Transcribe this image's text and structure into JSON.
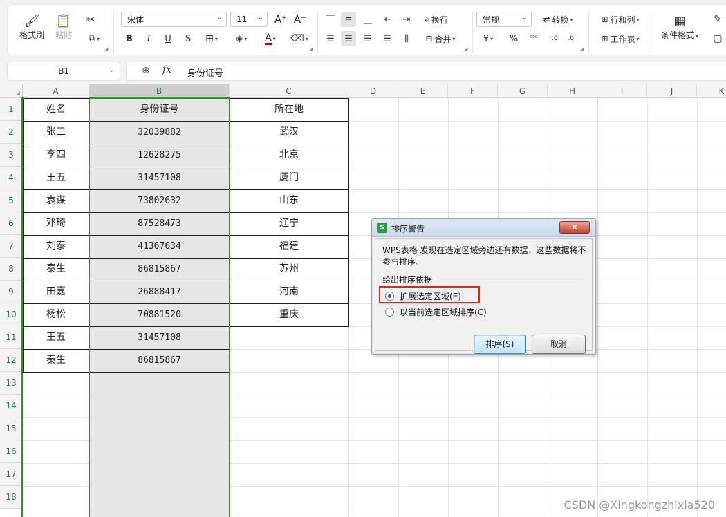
{
  "ribbon": {
    "format_painter": "格式刷",
    "paste": "粘贴",
    "font_name": "宋体",
    "font_size": "11",
    "wrap": "换行",
    "merge": "合并",
    "number_format": "常规",
    "convert": "转换",
    "rows_cols": "行和列",
    "worksheet": "工作表",
    "conditional_format": "条件格式",
    "bold": "B",
    "italic": "I",
    "underline": "U",
    "font_color_letter": "A",
    "currency": "¥",
    "percent": "%"
  },
  "formula_bar": {
    "name_box": "B1",
    "fx_label": "fx",
    "content": "身份证号"
  },
  "columns": [
    "A",
    "B",
    "C",
    "D",
    "E",
    "F",
    "G",
    "H",
    "I",
    "J",
    "K"
  ],
  "row_numbers": [
    "1",
    "2",
    "3",
    "4",
    "5",
    "6",
    "7",
    "8",
    "9",
    "10",
    "11",
    "12",
    "13",
    "14",
    "15",
    "16",
    "17",
    "18"
  ],
  "table": {
    "header": [
      "姓名",
      "身份证号",
      "所在地"
    ],
    "rows": [
      [
        "张三",
        "32039882",
        "武汉"
      ],
      [
        "李四",
        "12628275",
        "北京"
      ],
      [
        "王五",
        "31457108",
        "厦门"
      ],
      [
        "袁谋",
        "73802632",
        "山东"
      ],
      [
        "邓琦",
        "87528473",
        "辽宁"
      ],
      [
        "刘泰",
        "41367634",
        "福建"
      ],
      [
        "秦生",
        "86815867",
        "苏州"
      ],
      [
        "田嘉",
        "26888417",
        "河南"
      ],
      [
        "杨松",
        "70881520",
        "重庆"
      ],
      [
        "王五",
        "31457108",
        ""
      ],
      [
        "秦生",
        "86815867",
        ""
      ]
    ]
  },
  "dialog": {
    "title": "排序警告",
    "logo": "S",
    "message": "WPS表格 发现在选定区域旁边还有数据，这些数据将不参与排序。",
    "group_label": "给出排序依据",
    "option_expand": "扩展选定区域(E)",
    "option_current": "以当前选定区域排序(C)",
    "selected_option": "expand",
    "sort_button": "排序(S)",
    "cancel_button": "取消",
    "close": "✕"
  },
  "watermark": "CSDN @Xingkongzhixia520"
}
